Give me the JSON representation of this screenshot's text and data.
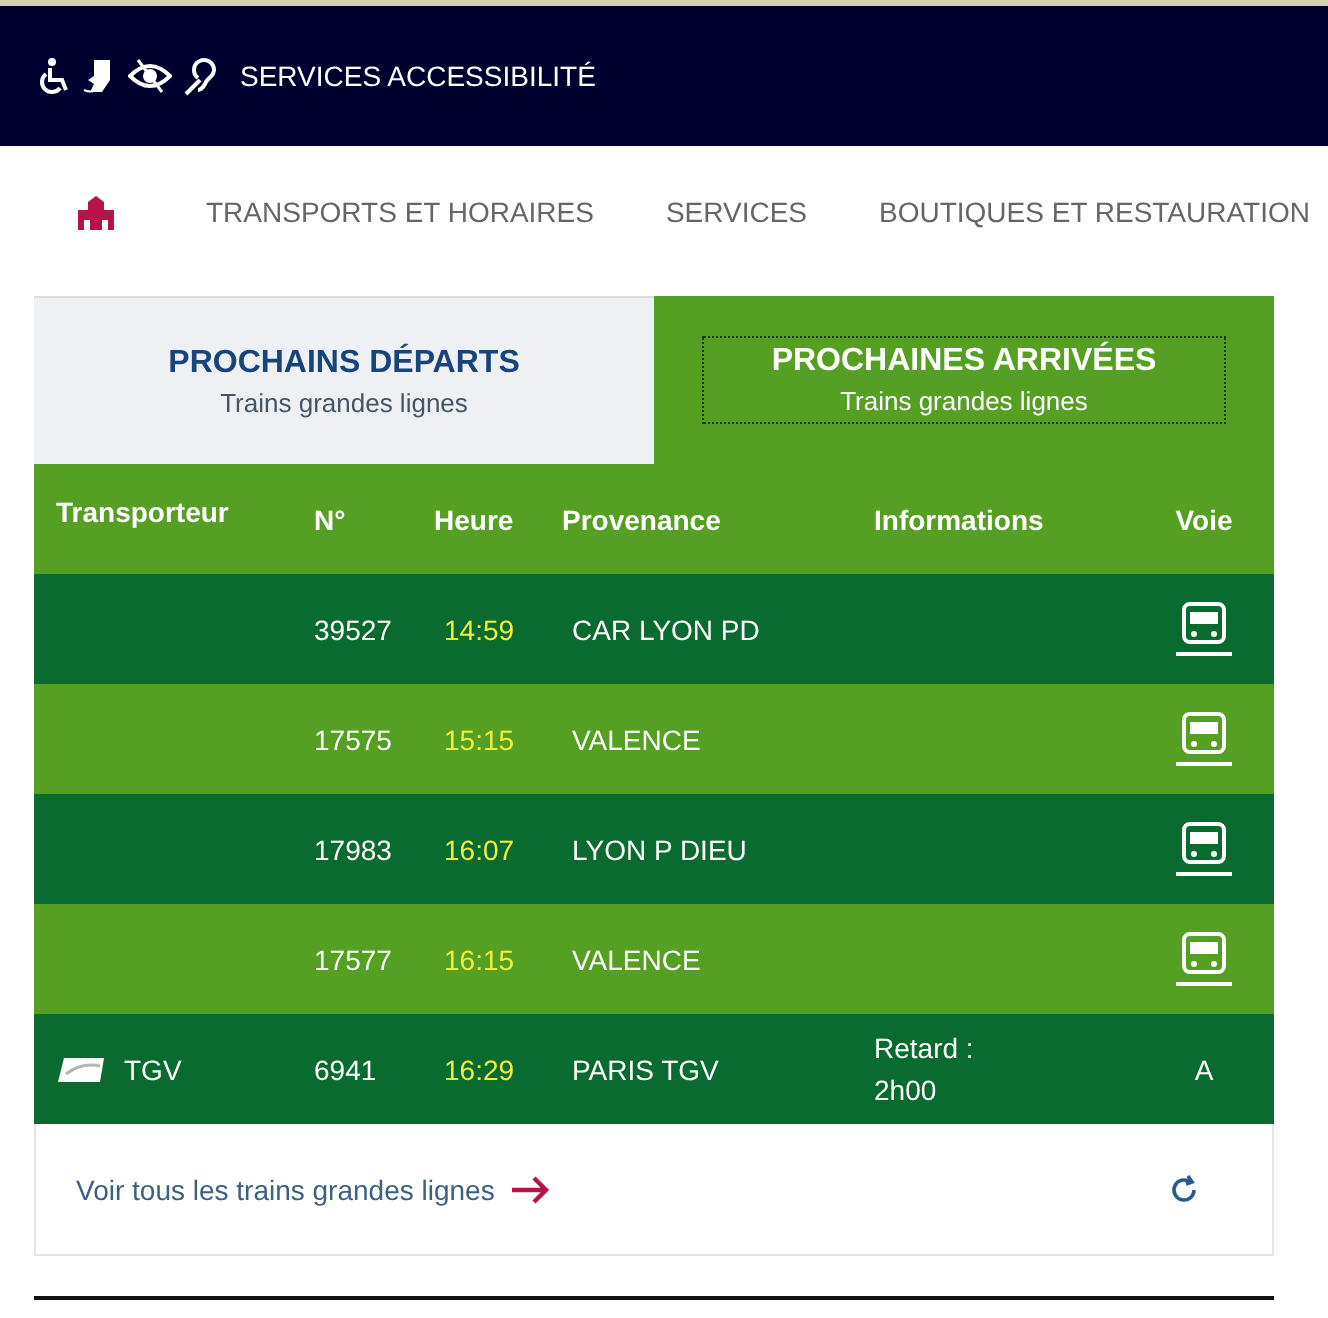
{
  "top_bar": {
    "label": "SERVICES ACCESSIBILITÉ"
  },
  "nav": {
    "items": [
      "TRANSPORTS ET HORAIRES",
      "SERVICES",
      "BOUTIQUES ET RESTAURATION"
    ]
  },
  "tabs": [
    {
      "title": "PROCHAINS DÉPARTS",
      "subtitle": "Trains grandes lignes",
      "selected": false
    },
    {
      "title": "PROCHAINES ARRIVÉES",
      "subtitle": "Trains grandes lignes",
      "selected": true
    }
  ],
  "table": {
    "columns": [
      "Transporteur",
      "N°",
      "Heure",
      "Provenance",
      "Informations",
      "Voie"
    ],
    "rows": [
      {
        "kind": "bus",
        "number": "39527",
        "time": "14:59",
        "origin": "CAR LYON PD"
      },
      {
        "kind": "bus",
        "number": "17575",
        "time": "15:15",
        "origin": "VALENCE"
      },
      {
        "kind": "bus",
        "number": "17983",
        "time": "16:07",
        "origin": "LYON P DIEU"
      },
      {
        "kind": "bus",
        "number": "17577",
        "time": "16:15",
        "origin": "VALENCE"
      },
      {
        "kind": "train",
        "carrier": "TGV",
        "number": "6941",
        "time": "16:29",
        "origin": "PARIS TGV",
        "info": "Retard : 2h00",
        "platform": "A"
      }
    ]
  },
  "footer": {
    "link": "Voir tous les trains grandes lignes"
  }
}
